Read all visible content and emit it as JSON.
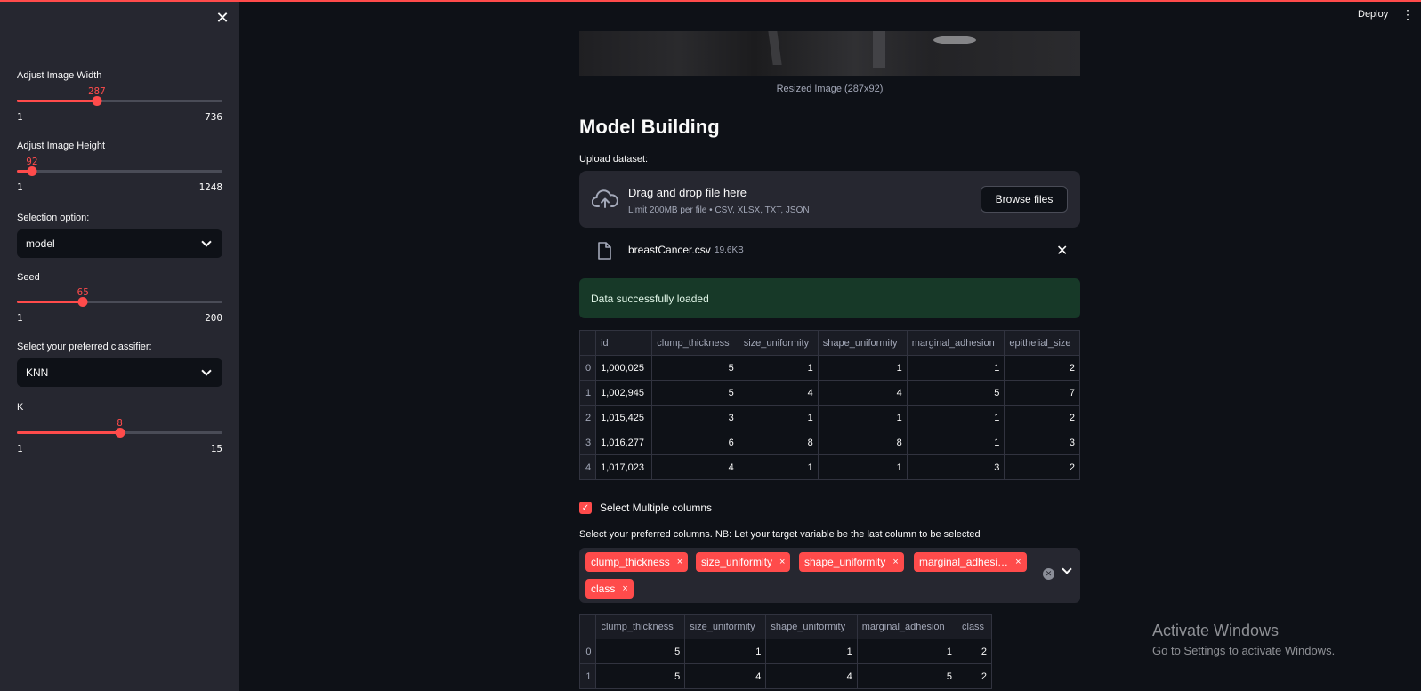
{
  "header": {
    "deploy_label": "Deploy",
    "menu_glyph": "⋮"
  },
  "sidebar": {
    "close_glyph": "✕",
    "width_slider": {
      "label": "Adjust Image Width",
      "value": "287",
      "min": "1",
      "max": "736",
      "value_num": 287,
      "min_num": 1,
      "max_num": 736
    },
    "height_slider": {
      "label": "Adjust Image Height",
      "value": "92",
      "min": "1",
      "max": "1248",
      "value_num": 92,
      "min_num": 1,
      "max_num": 1248
    },
    "selection": {
      "label": "Selection option:",
      "value": "model"
    },
    "seed_slider": {
      "label": "Seed",
      "value": "65",
      "min": "1",
      "max": "200",
      "value_num": 65,
      "min_num": 1,
      "max_num": 200
    },
    "classifier": {
      "label": "Select your preferred classifier:",
      "value": "KNN"
    },
    "k_slider": {
      "label": "K",
      "value": "8",
      "min": "1",
      "max": "15",
      "value_num": 8,
      "min_num": 1,
      "max_num": 15
    }
  },
  "main": {
    "image_caption": "Resized Image (287x92)",
    "heading": "Model Building",
    "upload": {
      "label": "Upload dataset:",
      "drop_title": "Drag and drop file here",
      "drop_limit": "Limit 200MB per file • CSV, XLSX, TXT, JSON",
      "browse_label": "Browse files",
      "file_name": "breastCancer.csv",
      "file_size": "19.6KB",
      "file_close": "✕"
    },
    "success_message": "Data successfully loaded",
    "table1": {
      "columns": [
        "id",
        "clump_thickness",
        "size_uniformity",
        "shape_uniformity",
        "marginal_adhesion",
        "epithelial_size"
      ],
      "rows": [
        [
          "0",
          "1,000,025",
          "5",
          "1",
          "1",
          "1",
          "2"
        ],
        [
          "1",
          "1,002,945",
          "5",
          "4",
          "4",
          "5",
          "7"
        ],
        [
          "2",
          "1,015,425",
          "3",
          "1",
          "1",
          "1",
          "2"
        ],
        [
          "3",
          "1,016,277",
          "6",
          "8",
          "8",
          "1",
          "3"
        ],
        [
          "4",
          "1,017,023",
          "4",
          "1",
          "1",
          "3",
          "2"
        ]
      ]
    },
    "multi_checkbox_label": "Select Multiple columns",
    "columns_label": "Select your preferred columns. NB: Let your target variable be the last column to be selected",
    "selected_tags": [
      "clump_thickness",
      "size_uniformity",
      "shape_uniformity",
      "marginal_adhesi…",
      "class"
    ],
    "tag_remove_glyph": "×",
    "table2": {
      "columns": [
        "clump_thickness",
        "size_uniformity",
        "shape_uniformity",
        "marginal_adhesion",
        "class"
      ],
      "rows": [
        [
          "0",
          "5",
          "1",
          "1",
          "1",
          "2"
        ],
        [
          "1",
          "5",
          "4",
          "4",
          "5",
          "2"
        ]
      ]
    }
  },
  "watermark": {
    "title": "Activate Windows",
    "subtitle": "Go to Settings to activate Windows."
  },
  "colors": {
    "accent": "#ff4b4b",
    "sidebar_bg": "#262730",
    "app_bg": "#0e1117",
    "success_bg": "#173928"
  }
}
